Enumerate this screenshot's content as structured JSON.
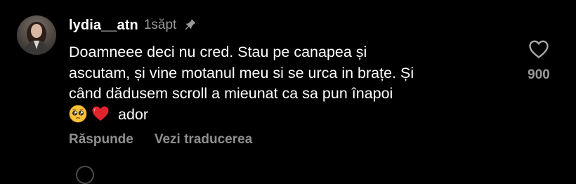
{
  "comment": {
    "username": "lydia__atn",
    "timestamp": "1săpt",
    "pinned": true,
    "text_lines": [
      "Doamneee deci nu cred. Stau pe canapea și",
      "ascutam, și vine motanul meu si se urca in brațe. Și",
      "când dădusem scroll a mieunat ca sa pun înapoi"
    ],
    "last_line_emojis": [
      "pleading-face-emoji",
      "red-heart-emoji"
    ],
    "last_line_text": "ador",
    "likes": "900",
    "actions": {
      "reply": "Răspunde",
      "translate": "Vezi traducerea"
    }
  },
  "colors": {
    "background": "#000000",
    "primary_text": "#ffffff",
    "secondary_text": "#9a9a9a",
    "heart_emoji": "#e0242e",
    "pleading_face": "#f7c23a"
  }
}
